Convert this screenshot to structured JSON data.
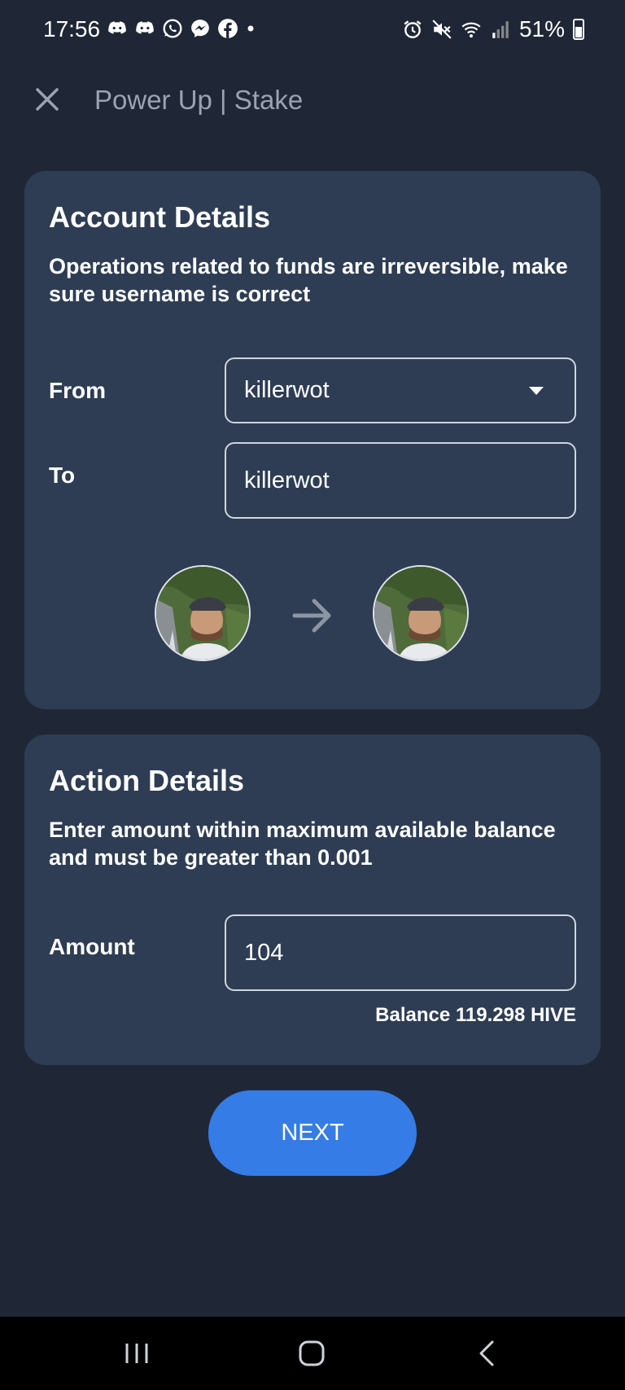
{
  "status_bar": {
    "time": "17:56",
    "left_icons": [
      "discord-icon",
      "discord-icon",
      "whatsapp-icon",
      "messenger-icon",
      "facebook-icon",
      "dot-icon"
    ],
    "right_icons": [
      "alarm-icon",
      "mute-icon",
      "wifi-icon",
      "signal-icon"
    ],
    "battery": "51%"
  },
  "header": {
    "title": "Power Up | Stake",
    "close_icon": "close-icon"
  },
  "account_details": {
    "title": "Account Details",
    "description": "Operations related to funds are irreversible, make sure username is correct",
    "from_label": "From",
    "from_value": "killerwot",
    "to_label": "To",
    "to_value": "killerwot"
  },
  "action_details": {
    "title": "Action Details",
    "description": "Enter amount within maximum available balance and must be greater than 0.001",
    "amount_label": "Amount",
    "amount_value": "104",
    "balance_text": "Balance 119.298 HIVE"
  },
  "next_button": {
    "label": "NEXT"
  },
  "nav_bar": {
    "buttons": [
      "recent-apps-icon",
      "home-icon",
      "back-icon"
    ]
  },
  "colors": {
    "background": "#1f2736",
    "card": "#2e3d53",
    "accent": "#357ce6"
  }
}
